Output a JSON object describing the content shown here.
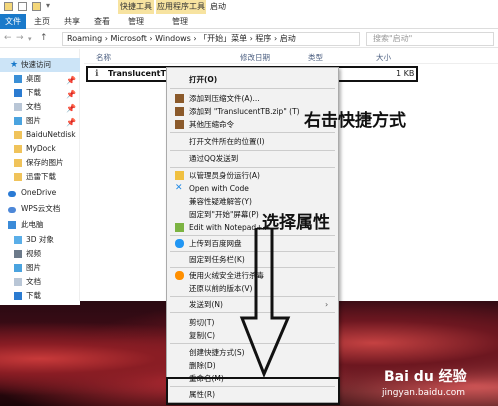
{
  "window": {
    "title": "启动",
    "context_tab_1": "快捷工具",
    "context_tab_2": "应用程序工具"
  },
  "ribbon": {
    "tabs": [
      "文件",
      "主页",
      "共享",
      "查看",
      "管理",
      "管理"
    ]
  },
  "address": {
    "path": "Roaming › Microsoft › Windows › 「开始」菜单 › 程序 › 启动",
    "search_placeholder": "搜索\"启动\""
  },
  "nav": {
    "items": [
      {
        "label": "快速访问",
        "pinned": false
      },
      {
        "label": "桌面",
        "pinned": true
      },
      {
        "label": "下载",
        "pinned": true
      },
      {
        "label": "文档",
        "pinned": true
      },
      {
        "label": "图片",
        "pinned": true
      },
      {
        "label": "BaiduNetdisk",
        "pinned": false
      },
      {
        "label": "MyDock",
        "pinned": false
      },
      {
        "label": "保存的图片",
        "pinned": false
      },
      {
        "label": "迅雷下载",
        "pinned": false
      },
      {
        "label": "OneDrive",
        "pinned": false
      },
      {
        "label": "WPS云文档",
        "pinned": false
      },
      {
        "label": "此电脑",
        "pinned": false
      },
      {
        "label": "3D 对象",
        "pinned": false
      },
      {
        "label": "视频",
        "pinned": false
      },
      {
        "label": "图片",
        "pinned": false
      },
      {
        "label": "文档",
        "pinned": false
      },
      {
        "label": "下载",
        "pinned": false
      }
    ]
  },
  "columns": {
    "name": "名称",
    "modified": "修改日期",
    "type": "类型",
    "size": "大小"
  },
  "file": {
    "name": "TranslucentTB",
    "size": "1 KB"
  },
  "context_menu": {
    "items": [
      {
        "label": "打开(O)"
      },
      {
        "label": "添加到压缩文件(A)..."
      },
      {
        "label": "添加到 \"TranslucentTB.zip\" (T)"
      },
      {
        "label": "其他压缩命令"
      },
      {
        "label": "打开文件所在的位置(I)"
      },
      {
        "label": "通过QQ发送到"
      },
      {
        "label": "以管理员身份运行(A)"
      },
      {
        "label": "Open with Code"
      },
      {
        "label": "兼容性疑难解答(Y)"
      },
      {
        "label": "固定到\"开始\"屏幕(P)"
      },
      {
        "label": "Edit with Notepad++"
      },
      {
        "label": "上传到百度网盘"
      },
      {
        "label": "固定到任务栏(K)"
      },
      {
        "label": "使用火绒安全进行杀毒"
      },
      {
        "label": "还原以前的版本(V)"
      },
      {
        "label": "发送到(N)"
      },
      {
        "label": "剪切(T)"
      },
      {
        "label": "复制(C)"
      },
      {
        "label": "创建快捷方式(S)"
      },
      {
        "label": "删除(D)"
      },
      {
        "label": "重命名(M)"
      },
      {
        "label": "属性(R)"
      }
    ]
  },
  "annotations": {
    "right_click": "右击快捷方式",
    "choose_props": "选择属性"
  },
  "watermark": {
    "logo": "Bai du 经验",
    "url": "jingyan.baidu.com"
  }
}
